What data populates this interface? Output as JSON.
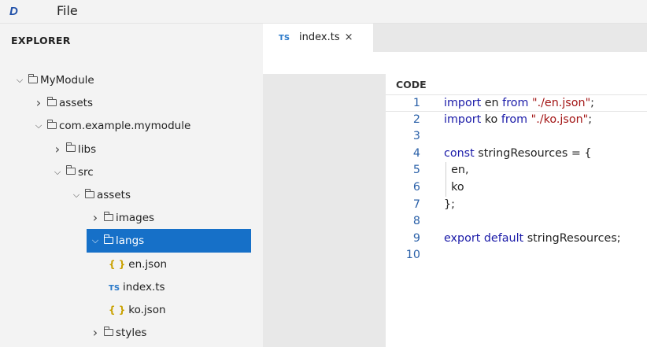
{
  "menubar": {
    "logo": "D",
    "file_label": "File"
  },
  "sidebar": {
    "title": "EXPLORER",
    "tree": [
      {
        "label": "MyModule",
        "kind": "folder",
        "chevron": "down",
        "depth": 0
      },
      {
        "label": "assets",
        "kind": "folder",
        "chevron": "right",
        "depth": 1
      },
      {
        "label": "com.example.mymodule",
        "kind": "folder",
        "chevron": "down",
        "depth": 1
      },
      {
        "label": "libs",
        "kind": "folder",
        "chevron": "right",
        "depth": 2
      },
      {
        "label": "src",
        "kind": "folder",
        "chevron": "down",
        "depth": 2
      },
      {
        "label": "assets",
        "kind": "folder",
        "chevron": "down",
        "depth": 3
      },
      {
        "label": "images",
        "kind": "folder",
        "chevron": "right",
        "depth": 4
      },
      {
        "label": "langs",
        "kind": "folder",
        "chevron": "down",
        "depth": 4,
        "selected": true
      },
      {
        "label": "en.json",
        "kind": "json",
        "icon_text": "{ }",
        "depth": 5
      },
      {
        "label": "index.ts",
        "kind": "ts",
        "icon_text": "TS",
        "depth": 5
      },
      {
        "label": "ko.json",
        "kind": "json",
        "icon_text": "{ }",
        "depth": 5
      },
      {
        "label": "styles",
        "kind": "folder",
        "chevron": "right",
        "depth": 4
      }
    ]
  },
  "editor": {
    "tab": {
      "icon_text": "TS",
      "label": "index.ts",
      "close_glyph": "×"
    },
    "code_title": "CODE",
    "lines": [
      {
        "n": "1",
        "tokens": [
          [
            "kw",
            "import"
          ],
          [
            "p",
            " en "
          ],
          [
            "kw",
            "from"
          ],
          [
            "p",
            " "
          ],
          [
            "str",
            "\"./en.json\""
          ],
          [
            "p",
            ";"
          ]
        ]
      },
      {
        "n": "2",
        "tokens": [
          [
            "kw",
            "import"
          ],
          [
            "p",
            " ko "
          ],
          [
            "kw",
            "from"
          ],
          [
            "p",
            " "
          ],
          [
            "str",
            "\"./ko.json\""
          ],
          [
            "p",
            ";"
          ]
        ]
      },
      {
        "n": "3",
        "tokens": []
      },
      {
        "n": "4",
        "tokens": [
          [
            "kw",
            "const"
          ],
          [
            "p",
            " stringResources = {"
          ]
        ]
      },
      {
        "n": "5",
        "tokens": [
          [
            "p",
            "  en,"
          ]
        ]
      },
      {
        "n": "6",
        "tokens": [
          [
            "p",
            "  ko"
          ]
        ]
      },
      {
        "n": "7",
        "tokens": [
          [
            "p",
            "};"
          ]
        ]
      },
      {
        "n": "8",
        "tokens": []
      },
      {
        "n": "9",
        "tokens": [
          [
            "kw",
            "export"
          ],
          [
            "p",
            " "
          ],
          [
            "kw",
            "default"
          ],
          [
            "p",
            " stringResources;"
          ]
        ]
      },
      {
        "n": "10",
        "tokens": []
      }
    ]
  },
  "colors": {
    "accent": "#1670c8",
    "keyword": "#1a1aa8",
    "string": "#a31515",
    "line_number": "#2a60a8"
  },
  "icons": [
    "logo-icon",
    "chevron-down-icon",
    "chevron-right-icon",
    "folder-icon",
    "json-file-icon",
    "ts-file-icon",
    "close-icon"
  ]
}
